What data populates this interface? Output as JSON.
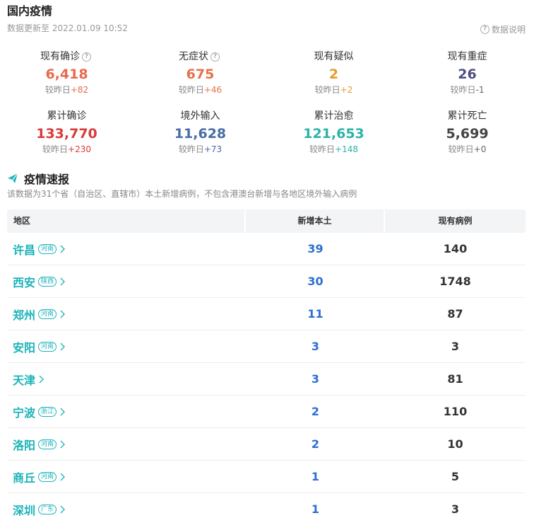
{
  "header": {
    "title": "国内疫情",
    "update_time": "数据更新至 2022.01.09 10:52",
    "explain_label": "数据说明"
  },
  "stats": [
    {
      "label": "现有确诊",
      "value": "6,418",
      "delta_prefix": "较昨日",
      "delta": "+82",
      "color": "#e86a4a",
      "delta_color": "#e86a4a",
      "help": true
    },
    {
      "label": "无症状",
      "value": "675",
      "delta_prefix": "较昨日",
      "delta": "+46",
      "color": "#e8704a",
      "delta_color": "#e8704a",
      "help": true
    },
    {
      "label": "现有疑似",
      "value": "2",
      "delta_prefix": "较昨日",
      "delta": "+2",
      "color": "#e89a2a",
      "delta_color": "#e89a2a",
      "help": false
    },
    {
      "label": "现有重症",
      "value": "26",
      "delta_prefix": "较昨日",
      "delta": "-1",
      "color": "#4c4f84",
      "delta_color": "#666666",
      "help": false
    },
    {
      "label": "累计确诊",
      "value": "133,770",
      "delta_prefix": "较昨日",
      "delta": "+230",
      "color": "#d93a3a",
      "delta_color": "#d93a3a",
      "help": false
    },
    {
      "label": "境外输入",
      "value": "11,628",
      "delta_prefix": "较昨日",
      "delta": "+73",
      "color": "#476da4",
      "delta_color": "#476da4",
      "help": false
    },
    {
      "label": "累计治愈",
      "value": "121,653",
      "delta_prefix": "较昨日",
      "delta": "+148",
      "color": "#2cb3a8",
      "delta_color": "#2cb3a8",
      "help": false
    },
    {
      "label": "累计死亡",
      "value": "5,699",
      "delta_prefix": "较昨日",
      "delta": "+0",
      "color": "#444444",
      "delta_color": "#666666",
      "help": false
    }
  ],
  "section": {
    "title": "疫情速报",
    "note": "该数据为31个省（自治区、直辖市）本土新增病例，不包含港澳台新增与各地区境外输入病例"
  },
  "table": {
    "headers": [
      "地区",
      "新增本土",
      "现有病例"
    ],
    "rows": [
      {
        "city": "许昌",
        "province": "河南",
        "new_local": "39",
        "existing": "140"
      },
      {
        "city": "西安",
        "province": "陕西",
        "new_local": "30",
        "existing": "1748"
      },
      {
        "city": "郑州",
        "province": "河南",
        "new_local": "11",
        "existing": "87"
      },
      {
        "city": "安阳",
        "province": "河南",
        "new_local": "3",
        "existing": "3"
      },
      {
        "city": "天津",
        "province": "",
        "new_local": "3",
        "existing": "81"
      },
      {
        "city": "宁波",
        "province": "浙江",
        "new_local": "2",
        "existing": "110"
      },
      {
        "city": "洛阳",
        "province": "河南",
        "new_local": "2",
        "existing": "10"
      },
      {
        "city": "商丘",
        "province": "河南",
        "new_local": "1",
        "existing": "5"
      },
      {
        "city": "深圳",
        "province": "广东",
        "new_local": "1",
        "existing": "3"
      }
    ]
  },
  "colors": {
    "accent": "#1ab3b9",
    "new_local": "#2d6fd1"
  },
  "icons": {
    "help": "question-circle-icon",
    "section": "paper-plane-icon",
    "row": "chevron-right-icon"
  }
}
